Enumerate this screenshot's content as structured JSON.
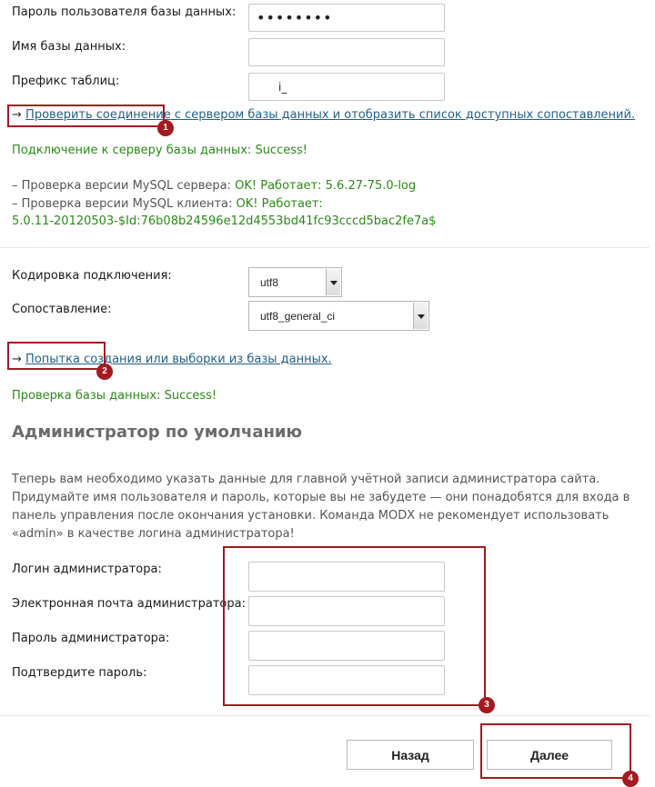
{
  "db": {
    "password_label": "Пароль пользователя базы данных:",
    "password_value": "••••••••",
    "dbname_label": "Имя базы данных:",
    "dbname_value": "",
    "prefix_label": "Префикс таблиц:",
    "prefix_value": "i_"
  },
  "test_connection": {
    "arrow": "→",
    "link_part1": "Проверить соединение",
    "link_part2": " с сервером базы данных и отобразить список доступных сопоставлений.",
    "result_label": "Подключение к серверу базы данных:",
    "result_value": "Success!",
    "server_check_label": "– Проверка версии MySQL сервера:",
    "server_check_value": "OK! Работает: 5.6.27-75.0-log",
    "client_check_label": "– Проверка версии MySQL клиента:",
    "client_check_value": "OK! Работает:",
    "client_version": "5.0.11-20120503-$Id:76b08b24596e12d4553bd41fc93cccd5bac2fe7a$"
  },
  "encoding": {
    "charset_label": "Кодировка подключения:",
    "charset_value": "utf8",
    "collation_label": "Сопоставление:",
    "collation_value": "utf8_general_ci"
  },
  "db_create": {
    "arrow": "→",
    "link": "Попытка создания или выборки из базы данных.",
    "result_label": "Проверка базы данных:",
    "result_value": "Success!"
  },
  "admin": {
    "heading": "Администратор по умолчанию",
    "description": "Теперь вам необходимо указать данные для главной учётной записи администратора сайта. Придумайте имя пользователя и пароль, которые вы не забудете — они понадобятся для входа в панель управления после окончания установки. Команда MODX не рекомендует использовать «admin» в качестве логина администратора!",
    "login_label": "Логин администратора:",
    "email_label": "Электронная почта администратора:",
    "password_label": "Пароль администратора:",
    "confirm_label": "Подтвердите пароль:"
  },
  "buttons": {
    "back": "Назад",
    "next": "Далее"
  },
  "annotations": {
    "badge1": "1",
    "badge2": "2",
    "badge3": "3",
    "badge4": "4",
    "color": "#a31a1f"
  },
  "colors": {
    "success": "#2a8a16",
    "link": "#1f5f8a"
  }
}
